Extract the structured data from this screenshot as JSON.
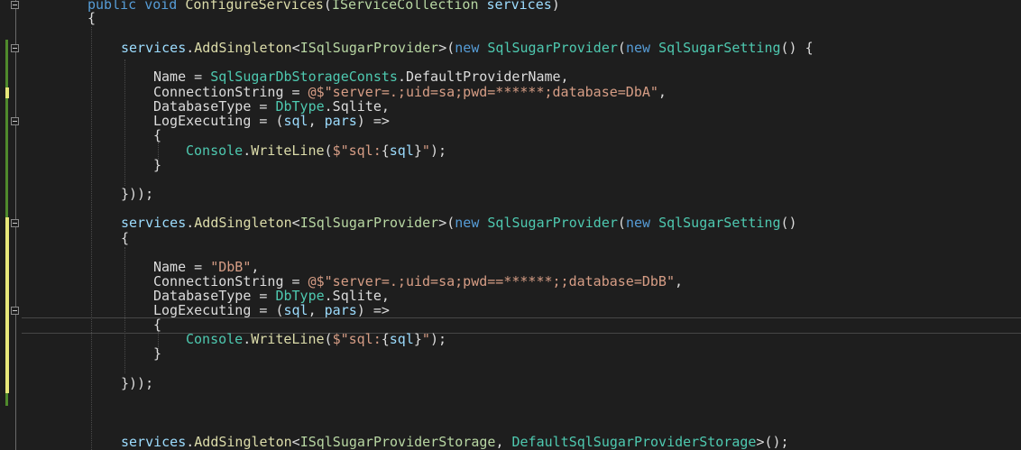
{
  "editor": {
    "lines": [
      {
        "tokens": [
          {
            "t": "kw",
            "v": "public"
          },
          {
            "t": "plain",
            "v": " "
          },
          {
            "t": "kw",
            "v": "void"
          },
          {
            "t": "plain",
            "v": " "
          },
          {
            "t": "method",
            "v": "ConfigureServices"
          },
          {
            "t": "plain",
            "v": "("
          },
          {
            "t": "iface",
            "v": "IServiceCollection"
          },
          {
            "t": "plain",
            "v": " "
          },
          {
            "t": "param",
            "v": "services"
          },
          {
            "t": "plain",
            "v": ")"
          }
        ]
      },
      {
        "tokens": [
          {
            "t": "plain",
            "v": "{"
          }
        ]
      },
      {
        "tokens": [
          {
            "t": "param",
            "v": "services"
          },
          {
            "t": "plain",
            "v": "."
          },
          {
            "t": "method",
            "v": "AddSingleton"
          },
          {
            "t": "plain",
            "v": "<"
          },
          {
            "t": "iface",
            "v": "ISqlSugarProvider"
          },
          {
            "t": "plain",
            "v": ">("
          },
          {
            "t": "kw",
            "v": "new"
          },
          {
            "t": "plain",
            "v": " "
          },
          {
            "t": "type",
            "v": "SqlSugarProvider"
          },
          {
            "t": "plain",
            "v": "("
          },
          {
            "t": "kw",
            "v": "new"
          },
          {
            "t": "plain",
            "v": " "
          },
          {
            "t": "type",
            "v": "SqlSugarSetting"
          },
          {
            "t": "plain",
            "v": "() {"
          }
        ]
      },
      {
        "tokens": [
          {
            "t": "plain",
            "v": "Name = "
          },
          {
            "t": "type",
            "v": "SqlSugarDbStorageConsts"
          },
          {
            "t": "plain",
            "v": ".DefaultProviderName,"
          }
        ]
      },
      {
        "tokens": [
          {
            "t": "plain",
            "v": "ConnectionString = "
          },
          {
            "t": "str",
            "v": "@$\"server=.;uid=sa;pwd=******;database=DbA\""
          },
          {
            "t": "plain",
            "v": ","
          }
        ]
      },
      {
        "tokens": [
          {
            "t": "plain",
            "v": "DatabaseType = "
          },
          {
            "t": "type",
            "v": "DbType"
          },
          {
            "t": "plain",
            "v": ".Sqlite,"
          }
        ]
      },
      {
        "tokens": [
          {
            "t": "plain",
            "v": "LogExecuting = ("
          },
          {
            "t": "param",
            "v": "sql"
          },
          {
            "t": "plain",
            "v": ", "
          },
          {
            "t": "param",
            "v": "pars"
          },
          {
            "t": "plain",
            "v": ") =>"
          }
        ]
      },
      {
        "tokens": [
          {
            "t": "plain",
            "v": "{"
          }
        ]
      },
      {
        "tokens": [
          {
            "t": "type",
            "v": "Console"
          },
          {
            "t": "plain",
            "v": "."
          },
          {
            "t": "method",
            "v": "WriteLine"
          },
          {
            "t": "plain",
            "v": "("
          },
          {
            "t": "str",
            "v": "$\"sql:"
          },
          {
            "t": "plain",
            "v": "{"
          },
          {
            "t": "param",
            "v": "sql"
          },
          {
            "t": "plain",
            "v": "}"
          },
          {
            "t": "str",
            "v": "\""
          },
          {
            "t": "plain",
            "v": ");"
          }
        ]
      },
      {
        "tokens": [
          {
            "t": "plain",
            "v": "}"
          }
        ]
      },
      {
        "tokens": [
          {
            "t": "plain",
            "v": "}));"
          }
        ]
      },
      {
        "tokens": [
          {
            "t": "param",
            "v": "services"
          },
          {
            "t": "plain",
            "v": "."
          },
          {
            "t": "method",
            "v": "AddSingleton"
          },
          {
            "t": "plain",
            "v": "<"
          },
          {
            "t": "iface",
            "v": "ISqlSugarProvider"
          },
          {
            "t": "plain",
            "v": ">("
          },
          {
            "t": "kw",
            "v": "new"
          },
          {
            "t": "plain",
            "v": " "
          },
          {
            "t": "type",
            "v": "SqlSugarProvider"
          },
          {
            "t": "plain",
            "v": "("
          },
          {
            "t": "kw",
            "v": "new"
          },
          {
            "t": "plain",
            "v": " "
          },
          {
            "t": "type",
            "v": "SqlSugarSetting"
          },
          {
            "t": "plain",
            "v": "()"
          }
        ]
      },
      {
        "tokens": [
          {
            "t": "plain",
            "v": "{"
          }
        ]
      },
      {
        "tokens": [
          {
            "t": "plain",
            "v": "Name = "
          },
          {
            "t": "str",
            "v": "\"DbB\""
          },
          {
            "t": "plain",
            "v": ","
          }
        ]
      },
      {
        "tokens": [
          {
            "t": "plain",
            "v": "ConnectionString = "
          },
          {
            "t": "str",
            "v": "@$\"server=.;uid=sa;pwd==******;;database=DbB\""
          },
          {
            "t": "plain",
            "v": ","
          }
        ]
      },
      {
        "tokens": [
          {
            "t": "plain",
            "v": "DatabaseType = "
          },
          {
            "t": "type",
            "v": "DbType"
          },
          {
            "t": "plain",
            "v": ".Sqlite,"
          }
        ]
      },
      {
        "tokens": [
          {
            "t": "plain",
            "v": "LogExecuting = ("
          },
          {
            "t": "param",
            "v": "sql"
          },
          {
            "t": "plain",
            "v": ", "
          },
          {
            "t": "param",
            "v": "pars"
          },
          {
            "t": "plain",
            "v": ") =>"
          }
        ]
      },
      {
        "tokens": [
          {
            "t": "plain",
            "v": "{"
          }
        ]
      },
      {
        "tokens": [
          {
            "t": "type",
            "v": "Console"
          },
          {
            "t": "plain",
            "v": "."
          },
          {
            "t": "method",
            "v": "WriteLine"
          },
          {
            "t": "plain",
            "v": "("
          },
          {
            "t": "str",
            "v": "$\"sql:"
          },
          {
            "t": "plain",
            "v": "{"
          },
          {
            "t": "param",
            "v": "sql"
          },
          {
            "t": "plain",
            "v": "}"
          },
          {
            "t": "str",
            "v": "\""
          },
          {
            "t": "plain",
            "v": ");"
          }
        ]
      },
      {
        "tokens": [
          {
            "t": "plain",
            "v": "}"
          }
        ]
      },
      {
        "tokens": [
          {
            "t": "plain",
            "v": "}));"
          }
        ]
      },
      {
        "tokens": [
          {
            "t": "param",
            "v": "services"
          },
          {
            "t": "plain",
            "v": "."
          },
          {
            "t": "method",
            "v": "AddSingleton"
          },
          {
            "t": "plain",
            "v": "<"
          },
          {
            "t": "iface",
            "v": "ISqlSugarProviderStorage"
          },
          {
            "t": "plain",
            "v": ", "
          },
          {
            "t": "type",
            "v": "DefaultSqlSugarProviderStorage"
          },
          {
            "t": "plain",
            "v": ">();"
          }
        ]
      }
    ]
  },
  "colors": {
    "background": "#1e1e1e",
    "keyword": "#569cd6",
    "type": "#4ec9b0",
    "string": "#d69d85",
    "interface": "#b8d7a3",
    "parameter": "#9cdcfe",
    "method": "#dcdcaa",
    "plain": "#dcdcdc",
    "change_saved": "#4f8a2c",
    "change_unsaved": "#e8e87a"
  }
}
